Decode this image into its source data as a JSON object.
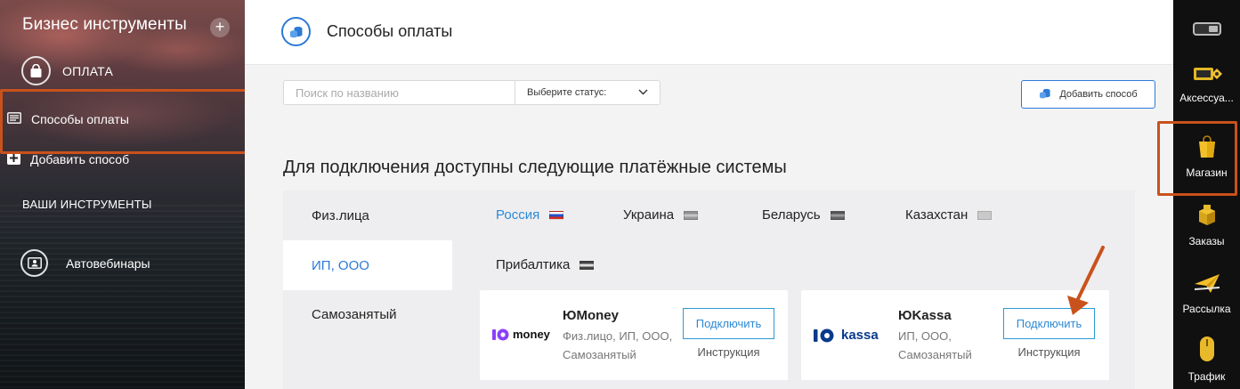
{
  "sidebar": {
    "title": "Бизнес инструменты",
    "add_symbol": "+",
    "section_payment": "ОПЛАТА",
    "items": [
      {
        "label": "Способы оплаты",
        "icon": "list-card-icon"
      },
      {
        "label": "Добавить способ",
        "icon": "plus-square-icon"
      }
    ],
    "section_tools": "ВАШИ ИНСТРУМЕНТЫ",
    "tools": [
      {
        "label": "Автовебинары",
        "icon": "id-card-icon"
      }
    ]
  },
  "header": {
    "title": "Способы оплаты"
  },
  "filters": {
    "search_placeholder": "Поиск по названию",
    "status_select": "Выберите статус:",
    "add_button": "Добавить способ"
  },
  "main": {
    "heading": "Для подключения доступны следующие платёжные системы",
    "entity_tabs": [
      {
        "label": "Физ.лица",
        "active": false
      },
      {
        "label": "ИП, ООО",
        "active": true
      },
      {
        "label": "Самозанятый",
        "active": false
      }
    ],
    "countries": [
      {
        "label": "Россия",
        "active": true
      },
      {
        "label": "Украина",
        "active": false
      },
      {
        "label": "Беларусь",
        "active": false
      },
      {
        "label": "Казахстан",
        "active": false
      },
      {
        "label": "Прибалтика",
        "active": false
      }
    ],
    "providers": [
      {
        "logo_text": "money",
        "name": "ЮMoney",
        "description": "Физ.лицо, ИП, ООО, Самозанятый",
        "connect_label": "Подключить",
        "instruction_label": "Инструкция"
      },
      {
        "logo_text": "kassa",
        "name": "ЮKassa",
        "description": "ИП, ООО, Самозанятый",
        "connect_label": "Подключить",
        "instruction_label": "Инструкция"
      }
    ]
  },
  "dock": {
    "items": [
      {
        "label": "Аксессуа...",
        "icon": "accessories-icon"
      },
      {
        "label": "Магазин",
        "icon": "shopping-bag-icon"
      },
      {
        "label": "Заказы",
        "icon": "orders-box-icon"
      },
      {
        "label": "Рассылка",
        "icon": "mailing-plane-icon"
      },
      {
        "label": "Трафик",
        "icon": "mouse-icon"
      }
    ]
  },
  "colors": {
    "accent_blue": "#2c7ad6",
    "highlight_orange": "#c9521c",
    "dock_bg": "#101010"
  }
}
